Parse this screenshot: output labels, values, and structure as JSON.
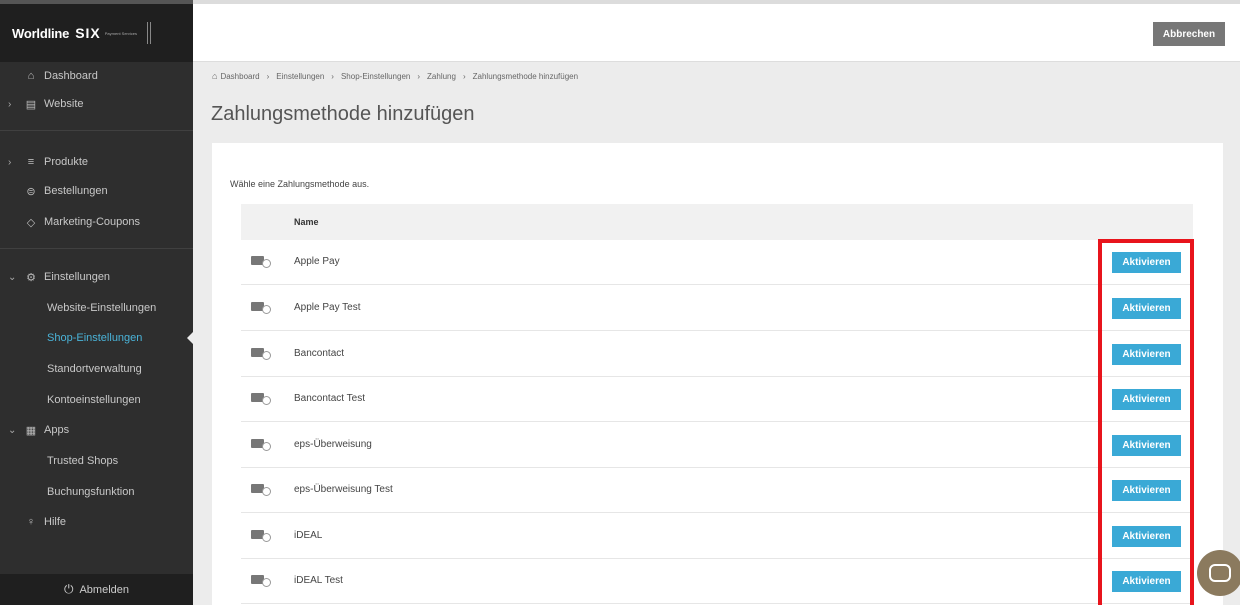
{
  "brand": {
    "name": "Worldline",
    "partner": "SIX",
    "partner_sub": "Payment Services"
  },
  "sidebar": {
    "items": [
      {
        "label": "Dashboard",
        "icon": "home-icon"
      },
      {
        "label": "Website",
        "icon": "website-icon"
      },
      {
        "label": "Produkte",
        "icon": "products-icon"
      },
      {
        "label": "Bestellungen",
        "icon": "orders-icon"
      },
      {
        "label": "Marketing-Coupons",
        "icon": "tag-icon"
      },
      {
        "label": "Einstellungen",
        "icon": "gear-icon"
      },
      {
        "label": "Website-Einstellungen"
      },
      {
        "label": "Shop-Einstellungen"
      },
      {
        "label": "Standortverwaltung"
      },
      {
        "label": "Kontoeinstellungen"
      },
      {
        "label": "Apps",
        "icon": "apps-icon"
      },
      {
        "label": "Trusted Shops"
      },
      {
        "label": "Buchungsfunktion"
      },
      {
        "label": "Hilfe",
        "icon": "help-icon"
      }
    ],
    "logout_label": "Abmelden"
  },
  "toolbar": {
    "cancel_label": "Abbrechen"
  },
  "breadcrumb": [
    "Dashboard",
    "Einstellungen",
    "Shop-Einstellungen",
    "Zahlung",
    "Zahlungsmethode hinzufügen"
  ],
  "page": {
    "title": "Zahlungsmethode hinzufügen",
    "hint": "Wähle eine Zahlungsmethode aus.",
    "column_name": "Name"
  },
  "payment_methods": [
    {
      "name": "Apple Pay",
      "action": "Aktivieren"
    },
    {
      "name": "Apple Pay Test",
      "action": "Aktivieren"
    },
    {
      "name": "Bancontact",
      "action": "Aktivieren"
    },
    {
      "name": "Bancontact Test",
      "action": "Aktivieren"
    },
    {
      "name": "eps-Überweisung",
      "action": "Aktivieren"
    },
    {
      "name": "eps-Überweisung Test",
      "action": "Aktivieren"
    },
    {
      "name": "iDEAL",
      "action": "Aktivieren"
    },
    {
      "name": "iDEAL Test",
      "action": "Aktivieren"
    }
  ],
  "colors": {
    "accent": "#3aa9d6",
    "active_nav": "#4ab3d8",
    "highlight": "#e8141c",
    "sidebar_bg": "#2e2e2e"
  }
}
